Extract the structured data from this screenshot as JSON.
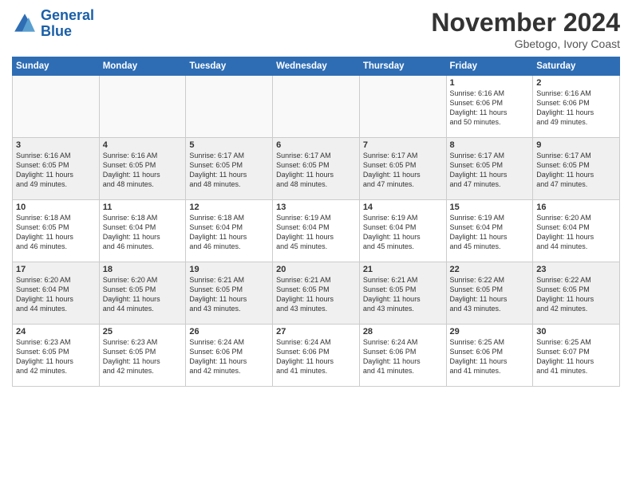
{
  "header": {
    "logo_line1": "General",
    "logo_line2": "Blue",
    "month_title": "November 2024",
    "subtitle": "Gbetogo, Ivory Coast"
  },
  "days_of_week": [
    "Sunday",
    "Monday",
    "Tuesday",
    "Wednesday",
    "Thursday",
    "Friday",
    "Saturday"
  ],
  "weeks": [
    [
      {
        "day": "",
        "info": ""
      },
      {
        "day": "",
        "info": ""
      },
      {
        "day": "",
        "info": ""
      },
      {
        "day": "",
        "info": ""
      },
      {
        "day": "",
        "info": ""
      },
      {
        "day": "1",
        "info": "Sunrise: 6:16 AM\nSunset: 6:06 PM\nDaylight: 11 hours\nand 50 minutes."
      },
      {
        "day": "2",
        "info": "Sunrise: 6:16 AM\nSunset: 6:06 PM\nDaylight: 11 hours\nand 49 minutes."
      }
    ],
    [
      {
        "day": "3",
        "info": "Sunrise: 6:16 AM\nSunset: 6:05 PM\nDaylight: 11 hours\nand 49 minutes."
      },
      {
        "day": "4",
        "info": "Sunrise: 6:16 AM\nSunset: 6:05 PM\nDaylight: 11 hours\nand 48 minutes."
      },
      {
        "day": "5",
        "info": "Sunrise: 6:17 AM\nSunset: 6:05 PM\nDaylight: 11 hours\nand 48 minutes."
      },
      {
        "day": "6",
        "info": "Sunrise: 6:17 AM\nSunset: 6:05 PM\nDaylight: 11 hours\nand 48 minutes."
      },
      {
        "day": "7",
        "info": "Sunrise: 6:17 AM\nSunset: 6:05 PM\nDaylight: 11 hours\nand 47 minutes."
      },
      {
        "day": "8",
        "info": "Sunrise: 6:17 AM\nSunset: 6:05 PM\nDaylight: 11 hours\nand 47 minutes."
      },
      {
        "day": "9",
        "info": "Sunrise: 6:17 AM\nSunset: 6:05 PM\nDaylight: 11 hours\nand 47 minutes."
      }
    ],
    [
      {
        "day": "10",
        "info": "Sunrise: 6:18 AM\nSunset: 6:05 PM\nDaylight: 11 hours\nand 46 minutes."
      },
      {
        "day": "11",
        "info": "Sunrise: 6:18 AM\nSunset: 6:04 PM\nDaylight: 11 hours\nand 46 minutes."
      },
      {
        "day": "12",
        "info": "Sunrise: 6:18 AM\nSunset: 6:04 PM\nDaylight: 11 hours\nand 46 minutes."
      },
      {
        "day": "13",
        "info": "Sunrise: 6:19 AM\nSunset: 6:04 PM\nDaylight: 11 hours\nand 45 minutes."
      },
      {
        "day": "14",
        "info": "Sunrise: 6:19 AM\nSunset: 6:04 PM\nDaylight: 11 hours\nand 45 minutes."
      },
      {
        "day": "15",
        "info": "Sunrise: 6:19 AM\nSunset: 6:04 PM\nDaylight: 11 hours\nand 45 minutes."
      },
      {
        "day": "16",
        "info": "Sunrise: 6:20 AM\nSunset: 6:04 PM\nDaylight: 11 hours\nand 44 minutes."
      }
    ],
    [
      {
        "day": "17",
        "info": "Sunrise: 6:20 AM\nSunset: 6:04 PM\nDaylight: 11 hours\nand 44 minutes."
      },
      {
        "day": "18",
        "info": "Sunrise: 6:20 AM\nSunset: 6:05 PM\nDaylight: 11 hours\nand 44 minutes."
      },
      {
        "day": "19",
        "info": "Sunrise: 6:21 AM\nSunset: 6:05 PM\nDaylight: 11 hours\nand 43 minutes."
      },
      {
        "day": "20",
        "info": "Sunrise: 6:21 AM\nSunset: 6:05 PM\nDaylight: 11 hours\nand 43 minutes."
      },
      {
        "day": "21",
        "info": "Sunrise: 6:21 AM\nSunset: 6:05 PM\nDaylight: 11 hours\nand 43 minutes."
      },
      {
        "day": "22",
        "info": "Sunrise: 6:22 AM\nSunset: 6:05 PM\nDaylight: 11 hours\nand 43 minutes."
      },
      {
        "day": "23",
        "info": "Sunrise: 6:22 AM\nSunset: 6:05 PM\nDaylight: 11 hours\nand 42 minutes."
      }
    ],
    [
      {
        "day": "24",
        "info": "Sunrise: 6:23 AM\nSunset: 6:05 PM\nDaylight: 11 hours\nand 42 minutes."
      },
      {
        "day": "25",
        "info": "Sunrise: 6:23 AM\nSunset: 6:05 PM\nDaylight: 11 hours\nand 42 minutes."
      },
      {
        "day": "26",
        "info": "Sunrise: 6:24 AM\nSunset: 6:06 PM\nDaylight: 11 hours\nand 42 minutes."
      },
      {
        "day": "27",
        "info": "Sunrise: 6:24 AM\nSunset: 6:06 PM\nDaylight: 11 hours\nand 41 minutes."
      },
      {
        "day": "28",
        "info": "Sunrise: 6:24 AM\nSunset: 6:06 PM\nDaylight: 11 hours\nand 41 minutes."
      },
      {
        "day": "29",
        "info": "Sunrise: 6:25 AM\nSunset: 6:06 PM\nDaylight: 11 hours\nand 41 minutes."
      },
      {
        "day": "30",
        "info": "Sunrise: 6:25 AM\nSunset: 6:07 PM\nDaylight: 11 hours\nand 41 minutes."
      }
    ]
  ]
}
